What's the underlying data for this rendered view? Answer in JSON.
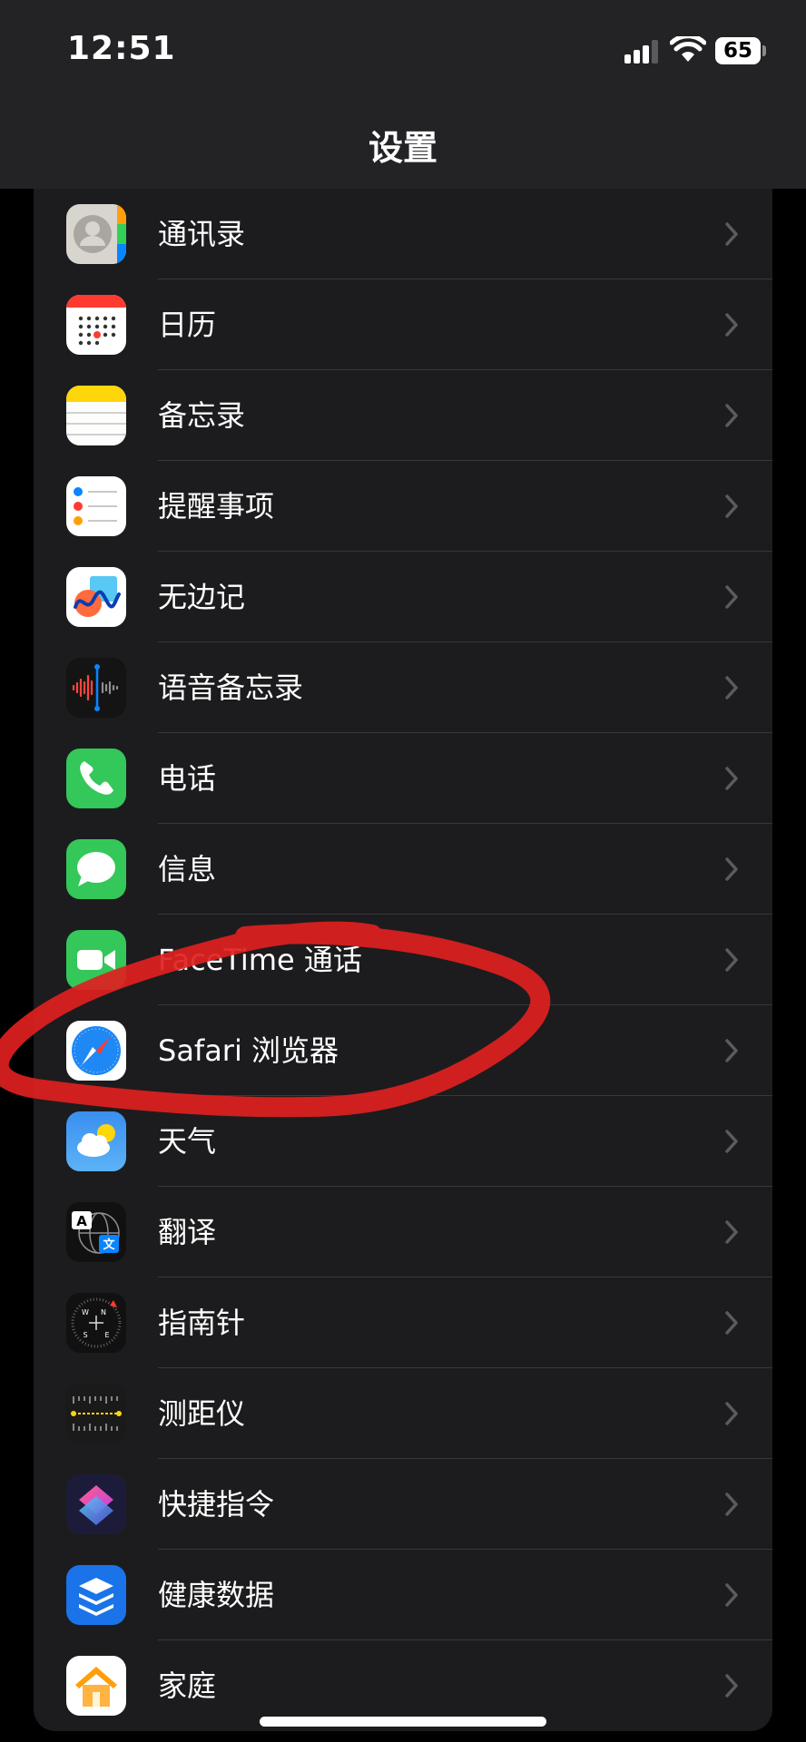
{
  "status_bar": {
    "time": "12:51",
    "battery": "65"
  },
  "nav": {
    "title": "设置"
  },
  "items": [
    {
      "label": "通讯录",
      "icon": "contacts-icon"
    },
    {
      "label": "日历",
      "icon": "calendar-icon"
    },
    {
      "label": "备忘录",
      "icon": "notes-icon"
    },
    {
      "label": "提醒事项",
      "icon": "reminders-icon"
    },
    {
      "label": "无边记",
      "icon": "freeform-icon"
    },
    {
      "label": "语音备忘录",
      "icon": "voice-memos-icon"
    },
    {
      "label": "电话",
      "icon": "phone-icon"
    },
    {
      "label": "信息",
      "icon": "messages-icon"
    },
    {
      "label": "FaceTime 通话",
      "icon": "facetime-icon"
    },
    {
      "label": "Safari 浏览器",
      "icon": "safari-icon"
    },
    {
      "label": "天气",
      "icon": "weather-icon"
    },
    {
      "label": "翻译",
      "icon": "translate-icon"
    },
    {
      "label": "指南针",
      "icon": "compass-icon"
    },
    {
      "label": "测距仪",
      "icon": "measure-icon"
    },
    {
      "label": "快捷指令",
      "icon": "shortcuts-icon"
    },
    {
      "label": "健康数据",
      "icon": "health-icon"
    },
    {
      "label": "家庭",
      "icon": "home-icon"
    }
  ],
  "icon_labels": {
    "translate_a": "A",
    "translate_zh": "文",
    "compass_w": "W",
    "compass_n": "N",
    "compass_s": "S",
    "compass_e": "E"
  },
  "colors": {
    "background": "#000000",
    "group": "#1c1c1e",
    "separator": "#38383a",
    "annotation": "#e0201f"
  }
}
